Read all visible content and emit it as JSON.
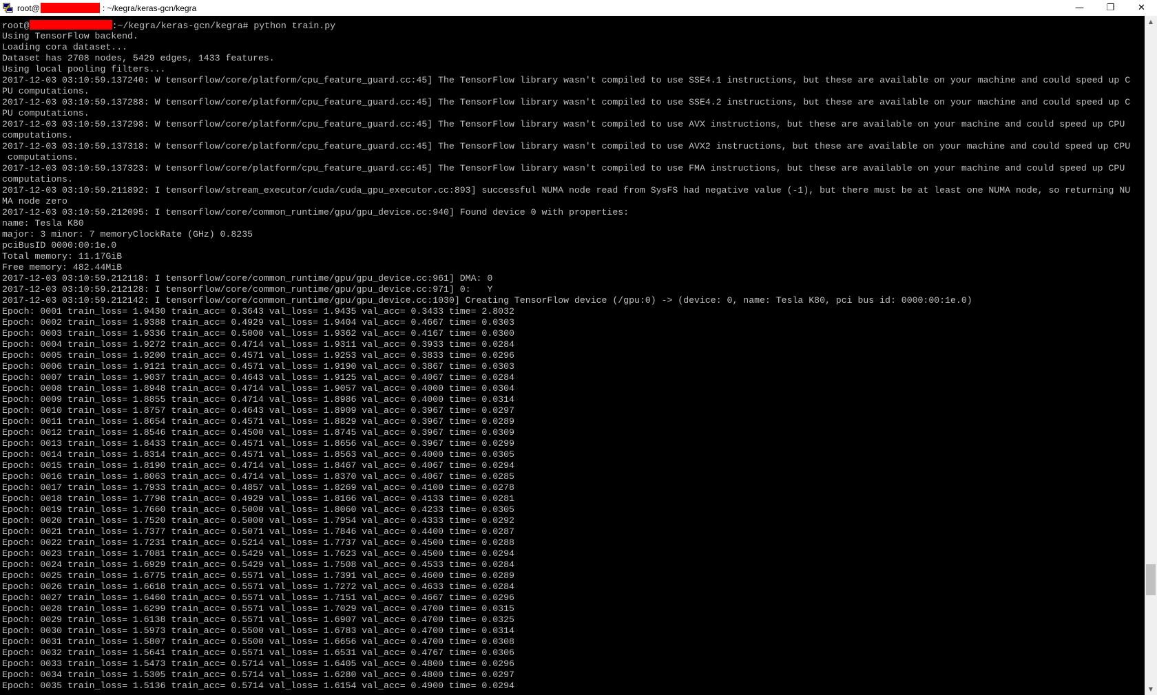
{
  "window": {
    "title_prefix": "root@",
    "title_suffix": ": ~/kegra/keras-gcn/kegra",
    "minimize_glyph": "—",
    "restore_glyph": "❐",
    "close_glyph": "✕",
    "app_icon": "putty-icon"
  },
  "prompt": {
    "user": "root@",
    "path_and_command": ":~/kegra/keras-gcn/kegra# python train.py"
  },
  "terminal_lines": [
    "Using TensorFlow backend.",
    "Loading cora dataset...",
    "Dataset has 2708 nodes, 5429 edges, 1433 features.",
    "Using local pooling filters...",
    "2017-12-03 03:10:59.137240: W tensorflow/core/platform/cpu_feature_guard.cc:45] The TensorFlow library wasn't compiled to use SSE4.1 instructions, but these are available on your machine and could speed up C",
    "PU computations.",
    "2017-12-03 03:10:59.137288: W tensorflow/core/platform/cpu_feature_guard.cc:45] The TensorFlow library wasn't compiled to use SSE4.2 instructions, but these are available on your machine and could speed up C",
    "PU computations.",
    "2017-12-03 03:10:59.137298: W tensorflow/core/platform/cpu_feature_guard.cc:45] The TensorFlow library wasn't compiled to use AVX instructions, but these are available on your machine and could speed up CPU",
    "computations.",
    "2017-12-03 03:10:59.137318: W tensorflow/core/platform/cpu_feature_guard.cc:45] The TensorFlow library wasn't compiled to use AVX2 instructions, but these are available on your machine and could speed up CPU",
    " computations.",
    "2017-12-03 03:10:59.137323: W tensorflow/core/platform/cpu_feature_guard.cc:45] The TensorFlow library wasn't compiled to use FMA instructions, but these are available on your machine and could speed up CPU",
    "computations.",
    "2017-12-03 03:10:59.211892: I tensorflow/stream_executor/cuda/cuda_gpu_executor.cc:893] successful NUMA node read from SysFS had negative value (-1), but there must be at least one NUMA node, so returning NU",
    "MA node zero",
    "2017-12-03 03:10:59.212095: I tensorflow/core/common_runtime/gpu/gpu_device.cc:940] Found device 0 with properties:",
    "name: Tesla K80",
    "major: 3 minor: 7 memoryClockRate (GHz) 0.8235",
    "pciBusID 0000:00:1e.0",
    "Total memory: 11.17GiB",
    "Free memory: 482.44MiB",
    "2017-12-03 03:10:59.212118: I tensorflow/core/common_runtime/gpu/gpu_device.cc:961] DMA: 0",
    "2017-12-03 03:10:59.212128: I tensorflow/core/common_runtime/gpu/gpu_device.cc:971] 0:   Y",
    "2017-12-03 03:10:59.212142: I tensorflow/core/common_runtime/gpu/gpu_device.cc:1030] Creating TensorFlow device (/gpu:0) -> (device: 0, name: Tesla K80, pci bus id: 0000:00:1e.0)",
    "Epoch: 0001 train_loss= 1.9430 train_acc= 0.3643 val_loss= 1.9435 val_acc= 0.3433 time= 2.8032",
    "Epoch: 0002 train_loss= 1.9388 train_acc= 0.4929 val_loss= 1.9404 val_acc= 0.4667 time= 0.0303",
    "Epoch: 0003 train_loss= 1.9336 train_acc= 0.5000 val_loss= 1.9362 val_acc= 0.4167 time= 0.0300",
    "Epoch: 0004 train_loss= 1.9272 train_acc= 0.4714 val_loss= 1.9311 val_acc= 0.3933 time= 0.0284",
    "Epoch: 0005 train_loss= 1.9200 train_acc= 0.4571 val_loss= 1.9253 val_acc= 0.3833 time= 0.0296",
    "Epoch: 0006 train_loss= 1.9121 train_acc= 0.4571 val_loss= 1.9190 val_acc= 0.3867 time= 0.0303",
    "Epoch: 0007 train_loss= 1.9037 train_acc= 0.4643 val_loss= 1.9125 val_acc= 0.4067 time= 0.0284",
    "Epoch: 0008 train_loss= 1.8948 train_acc= 0.4714 val_loss= 1.9057 val_acc= 0.4000 time= 0.0304",
    "Epoch: 0009 train_loss= 1.8855 train_acc= 0.4714 val_loss= 1.8986 val_acc= 0.4000 time= 0.0314",
    "Epoch: 0010 train_loss= 1.8757 train_acc= 0.4643 val_loss= 1.8909 val_acc= 0.3967 time= 0.0297",
    "Epoch: 0011 train_loss= 1.8654 train_acc= 0.4571 val_loss= 1.8829 val_acc= 0.3967 time= 0.0289",
    "Epoch: 0012 train_loss= 1.8546 train_acc= 0.4500 val_loss= 1.8745 val_acc= 0.3967 time= 0.0309",
    "Epoch: 0013 train_loss= 1.8433 train_acc= 0.4571 val_loss= 1.8656 val_acc= 0.3967 time= 0.0299",
    "Epoch: 0014 train_loss= 1.8314 train_acc= 0.4571 val_loss= 1.8563 val_acc= 0.4000 time= 0.0305",
    "Epoch: 0015 train_loss= 1.8190 train_acc= 0.4714 val_loss= 1.8467 val_acc= 0.4067 time= 0.0294",
    "Epoch: 0016 train_loss= 1.8063 train_acc= 0.4714 val_loss= 1.8370 val_acc= 0.4067 time= 0.0285",
    "Epoch: 0017 train_loss= 1.7933 train_acc= 0.4857 val_loss= 1.8269 val_acc= 0.4100 time= 0.0278",
    "Epoch: 0018 train_loss= 1.7798 train_acc= 0.4929 val_loss= 1.8166 val_acc= 0.4133 time= 0.0281",
    "Epoch: 0019 train_loss= 1.7660 train_acc= 0.5000 val_loss= 1.8060 val_acc= 0.4233 time= 0.0305",
    "Epoch: 0020 train_loss= 1.7520 train_acc= 0.5000 val_loss= 1.7954 val_acc= 0.4333 time= 0.0292",
    "Epoch: 0021 train_loss= 1.7377 train_acc= 0.5071 val_loss= 1.7846 val_acc= 0.4400 time= 0.0287",
    "Epoch: 0022 train_loss= 1.7231 train_acc= 0.5214 val_loss= 1.7737 val_acc= 0.4500 time= 0.0288",
    "Epoch: 0023 train_loss= 1.7081 train_acc= 0.5429 val_loss= 1.7623 val_acc= 0.4500 time= 0.0294",
    "Epoch: 0024 train_loss= 1.6929 train_acc= 0.5429 val_loss= 1.7508 val_acc= 0.4533 time= 0.0284",
    "Epoch: 0025 train_loss= 1.6775 train_acc= 0.5571 val_loss= 1.7391 val_acc= 0.4600 time= 0.0289",
    "Epoch: 0026 train_loss= 1.6618 train_acc= 0.5571 val_loss= 1.7272 val_acc= 0.4633 time= 0.0284",
    "Epoch: 0027 train_loss= 1.6460 train_acc= 0.5571 val_loss= 1.7151 val_acc= 0.4667 time= 0.0296",
    "Epoch: 0028 train_loss= 1.6299 train_acc= 0.5571 val_loss= 1.7029 val_acc= 0.4700 time= 0.0315",
    "Epoch: 0029 train_loss= 1.6138 train_acc= 0.5571 val_loss= 1.6907 val_acc= 0.4700 time= 0.0325",
    "Epoch: 0030 train_loss= 1.5973 train_acc= 0.5500 val_loss= 1.6783 val_acc= 0.4700 time= 0.0314",
    "Epoch: 0031 train_loss= 1.5807 train_acc= 0.5500 val_loss= 1.6656 val_acc= 0.4700 time= 0.0308",
    "Epoch: 0032 train_loss= 1.5641 train_acc= 0.5571 val_loss= 1.6531 val_acc= 0.4767 time= 0.0306",
    "Epoch: 0033 train_loss= 1.5473 train_acc= 0.5714 val_loss= 1.6405 val_acc= 0.4800 time= 0.0296",
    "Epoch: 0034 train_loss= 1.5305 train_acc= 0.5714 val_loss= 1.6280 val_acc= 0.4800 time= 0.0297",
    "Epoch: 0035 train_loss= 1.5136 train_acc= 0.5714 val_loss= 1.6154 val_acc= 0.4900 time= 0.0294"
  ],
  "colors": {
    "terminal_bg": "#000000",
    "terminal_fg": "#c0c0c0",
    "redaction": "#ff0000",
    "titlebar_bg": "#ffffff"
  }
}
